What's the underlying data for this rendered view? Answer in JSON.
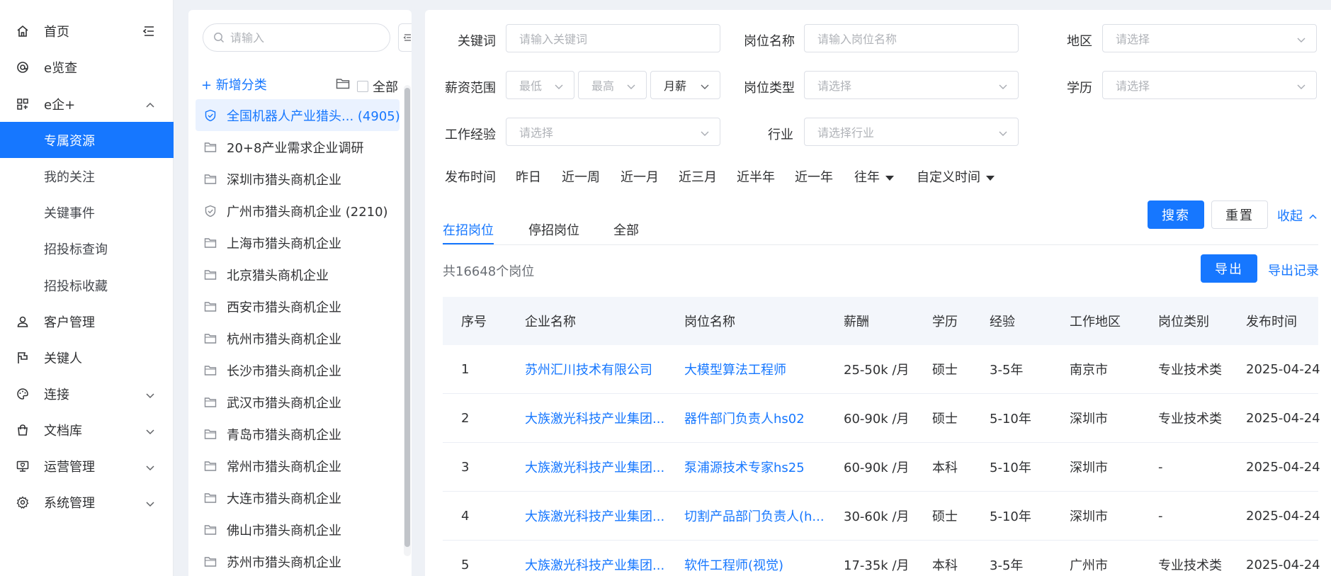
{
  "nav": {
    "items": [
      {
        "label": "首页",
        "icon": "home-icon"
      },
      {
        "label": "e览查",
        "icon": "at-icon"
      },
      {
        "label": "e企+",
        "icon": "grid-icon"
      },
      {
        "label": "专属资源"
      },
      {
        "label": "我的关注"
      },
      {
        "label": "关键事件"
      },
      {
        "label": "招投标查询"
      },
      {
        "label": "招投标收藏"
      },
      {
        "label": "客户管理",
        "icon": "user-icon"
      },
      {
        "label": "关键人",
        "icon": "flag-icon"
      },
      {
        "label": "连接",
        "icon": "palette-icon"
      },
      {
        "label": "文档库",
        "icon": "bag-icon"
      },
      {
        "label": "运营管理",
        "icon": "monitor-heart-icon"
      },
      {
        "label": "系统管理",
        "icon": "gear-icon"
      }
    ]
  },
  "categories": {
    "search_placeholder": "请输入",
    "add_label": "+ 新增分类",
    "all_label": "全部",
    "items": [
      {
        "label": "全国机器人产业猎头... (4905)",
        "icon": "shield-check-icon",
        "selected": true
      },
      {
        "label": "20+8产业需求企业调研",
        "icon": "folder-icon"
      },
      {
        "label": "深圳市猎头商机企业",
        "icon": "folder-icon"
      },
      {
        "label": "广州市猎头商机企业 (2210)",
        "icon": "shield-check-icon"
      },
      {
        "label": "上海市猎头商机企业",
        "icon": "folder-icon"
      },
      {
        "label": "北京猎头商机企业",
        "icon": "folder-icon"
      },
      {
        "label": "西安市猎头商机企业",
        "icon": "folder-icon"
      },
      {
        "label": "杭州市猎头商机企业",
        "icon": "folder-icon"
      },
      {
        "label": "长沙市猎头商机企业",
        "icon": "folder-icon"
      },
      {
        "label": "武汉市猎头商机企业",
        "icon": "folder-icon"
      },
      {
        "label": "青岛市猎头商机企业",
        "icon": "folder-icon"
      },
      {
        "label": "常州市猎头商机企业",
        "icon": "folder-icon"
      },
      {
        "label": "大连市猎头商机企业",
        "icon": "folder-icon"
      },
      {
        "label": "佛山市猎头商机企业",
        "icon": "folder-icon"
      },
      {
        "label": "苏州市猎头商机企业",
        "icon": "folder-icon"
      }
    ]
  },
  "filters": {
    "keyword_label": "关键词",
    "keyword_placeholder": "请输入关键词",
    "position_label": "岗位名称",
    "position_placeholder": "请输入岗位名称",
    "region_label": "地区",
    "region_placeholder": "请选择",
    "salary_label": "薪资范围",
    "salary_min": "最低",
    "salary_max": "最高",
    "salary_unit": "月薪",
    "job_type_label": "岗位类型",
    "job_type_placeholder": "请选择",
    "education_label": "学历",
    "education_placeholder": "请选择",
    "experience_label": "工作经验",
    "experience_placeholder": "请选择",
    "industry_label": "行业",
    "industry_placeholder": "请选择行业",
    "publish_label": "发布时间",
    "publish_options": [
      "昨日",
      "近一周",
      "近一月",
      "近三月",
      "近半年",
      "近一年",
      "往年",
      "自定义时间"
    ],
    "search_button": "搜索",
    "reset_button": "重置",
    "collapse_link": "收起"
  },
  "tabs": [
    "在招岗位",
    "停招岗位",
    "全部"
  ],
  "summary": {
    "count_text": "共16648个岗位",
    "export_button": "导出",
    "export_record_link": "导出记录"
  },
  "table": {
    "headers": [
      "序号",
      "企业名称",
      "岗位名称",
      "薪酬",
      "学历",
      "经验",
      "工作地区",
      "岗位类别",
      "发布时间"
    ],
    "rows": [
      [
        "1",
        "苏州汇川技术有限公司",
        "大模型算法工程师",
        "25-50k /月",
        "硕士",
        "3-5年",
        "南京市",
        "专业技术类",
        "2025-04-24"
      ],
      [
        "2",
        "大族激光科技产业集团...",
        "器件部门负责人hs02",
        "60-90k /月",
        "硕士",
        "5-10年",
        "深圳市",
        "专业技术类",
        "2025-04-24"
      ],
      [
        "3",
        "大族激光科技产业集团...",
        "泵浦源技术专家hs25",
        "60-90k /月",
        "本科",
        "5-10年",
        "深圳市",
        "-",
        "2025-04-24"
      ],
      [
        "4",
        "大族激光科技产业集团...",
        "切割产品部门负责人(h...",
        "30-60k /月",
        "硕士",
        "5-10年",
        "深圳市",
        "-",
        "2025-04-24"
      ],
      [
        "5",
        "大族激光科技产业集团...",
        "软件工程师(视觉)",
        "17-35k /月",
        "本科",
        "3-5年",
        "广州市",
        "专业技术类",
        "2025-04-24"
      ]
    ]
  },
  "colors": {
    "accent": "#1677ff",
    "link": "#1677ff",
    "header_bg": "#f3f6fb"
  }
}
